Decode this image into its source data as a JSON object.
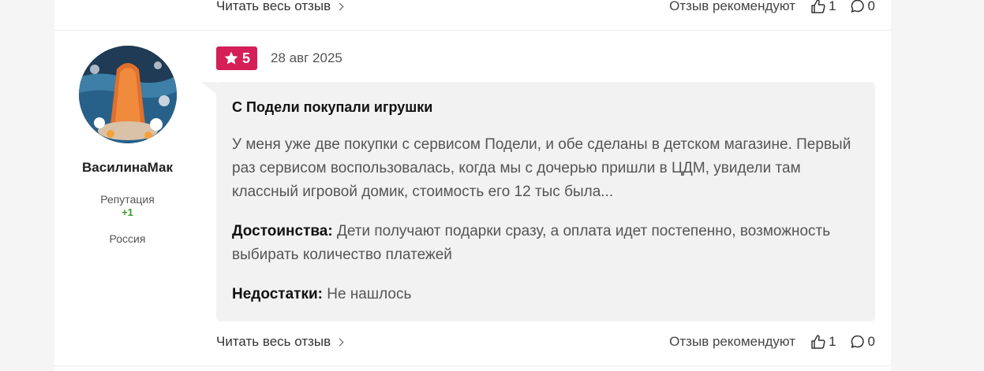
{
  "prev_review": {
    "read_more": "Читать весь отзыв",
    "recommend_label": "Отзыв рекомендуют",
    "likes": "1",
    "comments": "0"
  },
  "review": {
    "author": {
      "name": "ВасилинаМак",
      "reputation_label": "Репутация",
      "reputation_value": "+1",
      "country": "Россия"
    },
    "rating": "5",
    "date": "28 авг 2025",
    "title": "С Подели покупали игрушки",
    "text": "У меня уже две покупки с сервисом Подели, и обе сделаны в детском магазине. Первый раз сервисом воспользовалась, когда мы с дочерью пришли в ЦДМ, увидели там классный игровой домик, стоимость его 12 тыс была...",
    "pros_label": "Достоинства:",
    "pros": "Дети получают подарки сразу, а оплата идет постепенно, возможность выбирать количество платежей",
    "cons_label": "Недостатки:",
    "cons": "Не нашлось",
    "read_more": "Читать весь отзыв",
    "recommend_label": "Отзыв рекомендуют",
    "likes": "1",
    "comments": "0"
  },
  "colors": {
    "rating_badge": "#d41f57",
    "reputation_positive": "#3a9b2e",
    "bubble_bg": "#f2f2f2"
  },
  "icons": [
    "chevron-right-icon",
    "thumbs-up-icon",
    "comment-icon",
    "star-icon"
  ]
}
